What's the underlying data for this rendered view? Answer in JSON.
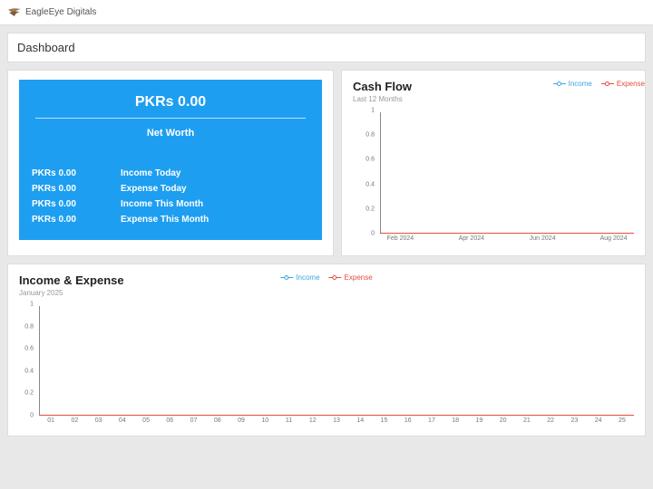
{
  "brand": "EagleEye Digitals",
  "page_title": "Dashboard",
  "net_worth_card": {
    "amount": "PKRs 0.00",
    "label": "Net Worth",
    "stats": [
      {
        "value": "PKRs 0.00",
        "label": "Income Today"
      },
      {
        "value": "PKRs 0.00",
        "label": "Expense Today"
      },
      {
        "value": "PKRs 0.00",
        "label": "Income This Month"
      },
      {
        "value": "PKRs 0.00",
        "label": "Expense This Month"
      }
    ]
  },
  "cash_flow": {
    "title": "Cash Flow",
    "subtitle": "Last 12 Months",
    "legend": {
      "income": "Income",
      "expense": "Expense"
    }
  },
  "income_expense": {
    "title": "Income & Expense",
    "subtitle": "January 2025",
    "legend": {
      "income": "Income",
      "expense": "Expense"
    }
  },
  "chart_data": [
    {
      "type": "line",
      "title": "Cash Flow",
      "subtitle": "Last 12 Months",
      "xlabel": "",
      "ylabel": "",
      "ylim": [
        0,
        1
      ],
      "y_ticks": [
        0,
        0.2,
        0.4,
        0.6,
        0.8,
        1
      ],
      "categories": [
        "Feb 2024",
        "Apr 2024",
        "Jun 2024",
        "Aug 2024"
      ],
      "series": [
        {
          "name": "Income",
          "values": [
            0,
            0,
            0,
            0
          ]
        },
        {
          "name": "Expense",
          "values": [
            0,
            0,
            0,
            0
          ]
        }
      ]
    },
    {
      "type": "line",
      "title": "Income & Expense",
      "subtitle": "January 2025",
      "xlabel": "",
      "ylabel": "",
      "ylim": [
        0,
        1
      ],
      "y_ticks": [
        0,
        0.2,
        0.4,
        0.6,
        0.8,
        1
      ],
      "categories": [
        "01",
        "02",
        "03",
        "04",
        "05",
        "06",
        "07",
        "08",
        "09",
        "10",
        "11",
        "12",
        "13",
        "14",
        "15",
        "16",
        "17",
        "18",
        "19",
        "20",
        "21",
        "22",
        "23",
        "24",
        "25"
      ],
      "series": [
        {
          "name": "Income",
          "values": [
            0,
            0,
            0,
            0,
            0,
            0,
            0,
            0,
            0,
            0,
            0,
            0,
            0,
            0,
            0,
            0,
            0,
            0,
            0,
            0,
            0,
            0,
            0,
            0,
            0
          ]
        },
        {
          "name": "Expense",
          "values": [
            0,
            0,
            0,
            0,
            0,
            0,
            0,
            0,
            0,
            0,
            0,
            0,
            0,
            0,
            0,
            0,
            0,
            0,
            0,
            0,
            0,
            0,
            0,
            0,
            0
          ]
        }
      ]
    }
  ]
}
